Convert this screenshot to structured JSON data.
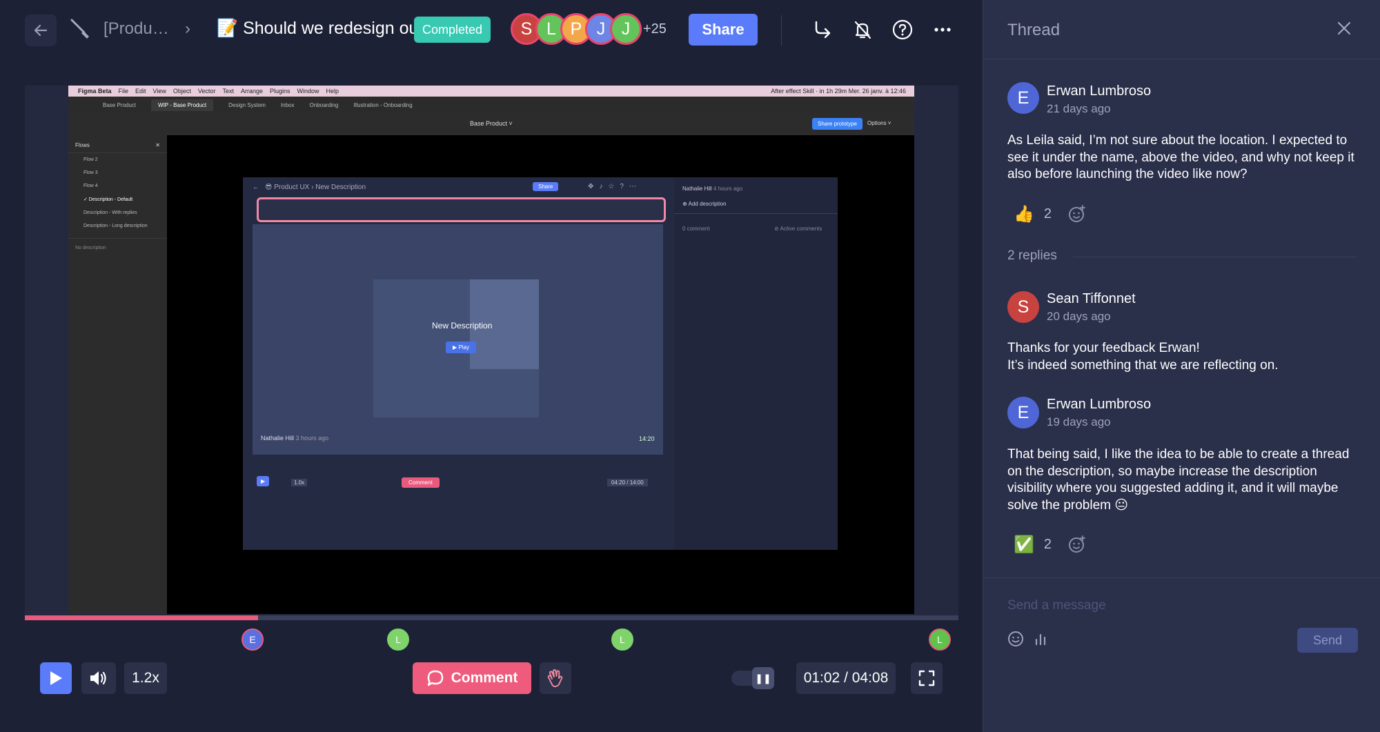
{
  "colors": {
    "accent": "#5b7cfa",
    "comment": "#ee5b7c",
    "completed": "#37c9b2",
    "progress": "#e85b7d"
  },
  "header": {
    "crumb_parent": "[Produ…",
    "crumb_sep": "›",
    "title": "📝 Should we redesign ou…",
    "status": "Completed",
    "participants": [
      {
        "initial": "S",
        "color": "#c8433f"
      },
      {
        "initial": "L",
        "color": "#62c45a"
      },
      {
        "initial": "P",
        "color": "#f2a84a"
      },
      {
        "initial": "J",
        "color": "#6d86e6"
      },
      {
        "initial": "J",
        "color": "#62c45a"
      }
    ],
    "more_participants": "+25",
    "share_label": "Share",
    "icons": [
      "back-arrow-icon",
      "brush-icon",
      "forward-icon",
      "bell-off-icon",
      "help-icon",
      "more-icon"
    ]
  },
  "video": {
    "figma_menubar": [
      "Figma Beta",
      "File",
      "Edit",
      "View",
      "Object",
      "Vector",
      "Text",
      "Arrange",
      "Plugins",
      "Window",
      "Help"
    ],
    "figma_menubar_right": "After effect Skill · in 1h 29m   Mer. 26 janv. à 12:46",
    "figma_tabs": [
      "Base Product",
      "WIP - Base Product",
      "Design System",
      "Inbox",
      "Onboarding",
      "Illustration - Onboarding"
    ],
    "figma_center": "Base Product ˅",
    "figma_share_proto": "Share prototype",
    "figma_options": "Options ˅",
    "flows_header": "Flows",
    "flows": [
      "Flow 2",
      "Flow 3",
      "Flow 4",
      "✓ Description - Default",
      "Description - With replies",
      "Description - Long description"
    ],
    "no_description": "No description",
    "inner_breadcrumb": "😎  Product UX  ›  New Description",
    "inner_share": "Share",
    "inner_title": "New Description",
    "inner_play": "▶ Play",
    "inner_author": "Nathalie Hill",
    "inner_author_time": "3 hours ago",
    "inner_time": "14:20",
    "inner_speed": "1.0x",
    "inner_comment": "Comment",
    "inner_timecode": "04:20 / 14:00",
    "inner_side_author": "Nathalie Hill",
    "inner_side_time": "4 hours ago",
    "inner_add_desc": "⊕ Add description",
    "inner_comments": "0 comment",
    "inner_active": "⊘ Active comments"
  },
  "player": {
    "progress": 0.25,
    "markers": [
      {
        "initial": "E",
        "color": "#5b6fe0",
        "border": "#e85b7d",
        "pos": 0.244
      },
      {
        "initial": "L",
        "color": "#7ed36a",
        "border": "#7ed36a",
        "pos": 0.4
      },
      {
        "initial": "L",
        "color": "#7ed36a",
        "border": "#7ed36a",
        "pos": 0.64
      },
      {
        "initial": "L",
        "color": "#5fc24a",
        "border": "#e85b7d",
        "pos": 0.98
      }
    ],
    "speed": "1.2x",
    "comment_label": "Comment",
    "time": "01:02 / 04:08"
  },
  "thread": {
    "title": "Thread",
    "messages": [
      {
        "initial": "E",
        "color": "#4f66d6",
        "author": "Erwan Lumbroso",
        "time": "21 days ago",
        "body": "As Leila said, I’m not sure about the location. I expected to see it under the name, above the video, and why not keep it also before launching the video like now?",
        "reaction_emoji": "👍",
        "reaction_count": "2"
      },
      {
        "initial": "S",
        "color": "#c8433f",
        "author": "Sean Tiffonnet",
        "time": "20 days ago",
        "body_lines": [
          "Thanks for your feedback Erwan!",
          "It’s indeed something that we are reflecting on."
        ]
      },
      {
        "initial": "E",
        "color": "#4f66d6",
        "author": "Erwan Lumbroso",
        "time": "19 days ago",
        "body": "That being said, I like the idea to be able to create a thread on the description, so maybe increase the description visibility where you suggested adding it, and it will maybe solve the problem 😐",
        "reaction_emoji": "✅",
        "reaction_count": "2"
      }
    ],
    "replies_label": "2 replies",
    "composer_placeholder": "Send a message",
    "send_label": "Send"
  }
}
